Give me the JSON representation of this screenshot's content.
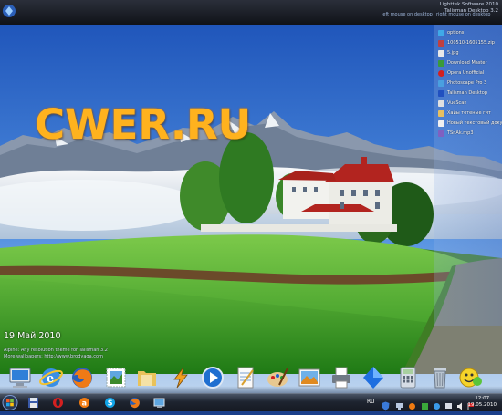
{
  "topbar": {
    "info_line1": "Lighttek Software 2010",
    "info_line2": "Talisman Desktop 3.2",
    "note_left": "left mouse on desktop",
    "note_right": "right mouse on desktop"
  },
  "desktop": {
    "logo": "CWER.RU",
    "date": "19  Май  2010",
    "credit_line1": "Alpine: Any resolution theme for Talisman 3.2",
    "credit_line2": "More wallpapers: http://www.brodyaga.com"
  },
  "side_icons": [
    {
      "label": "options",
      "icon": "options-icon",
      "color": "#3fa9e8"
    },
    {
      "label": "100510-1605155.zip",
      "icon": "archive-icon",
      "color": "#c04040"
    },
    {
      "label": "5.jpg",
      "icon": "image-file-icon",
      "color": "#e8e8e8"
    },
    {
      "label": "Download Master",
      "icon": "download-master-icon",
      "color": "#3a9a3a"
    },
    {
      "label": "Opera Unofficial",
      "icon": "opera-icon",
      "color": "#d42020"
    },
    {
      "label": "Photoscape Pro 3",
      "icon": "photo-icon",
      "color": "#4aa0e0"
    },
    {
      "label": "Talisman Desktop",
      "icon": "talisman-icon",
      "color": "#2050c0"
    },
    {
      "label": "VueScan",
      "icon": "scanner-icon",
      "color": "#e0e0e0"
    },
    {
      "label": "Хайы тотеные гит",
      "icon": "folder-icon",
      "color": "#e8c060"
    },
    {
      "label": "Новый текстовый докуме...",
      "icon": "text-document-icon",
      "color": "#f0f0f0"
    },
    {
      "label": "TSnAk.mp3",
      "icon": "audio-file-icon",
      "color": "#8060c0"
    }
  ],
  "dock_icons": [
    {
      "name": "my-computer-icon"
    },
    {
      "name": "internet-explorer-icon"
    },
    {
      "name": "firefox-icon"
    },
    {
      "name": "mail-stamp-icon"
    },
    {
      "name": "documents-folder-icon"
    },
    {
      "name": "winamp-icon"
    },
    {
      "name": "media-player-icon"
    },
    {
      "name": "notepad-icon"
    },
    {
      "name": "paint-icon"
    },
    {
      "name": "photo-viewer-icon"
    },
    {
      "name": "printer-icon"
    },
    {
      "name": "blue-crystal-icon"
    },
    {
      "name": "calculator-icon"
    },
    {
      "name": "recycle-bin-icon"
    },
    {
      "name": "smiley-messenger-icon"
    }
  ],
  "taskbar": {
    "language": "RU",
    "time": "12:07",
    "date": "19.05.2010"
  }
}
